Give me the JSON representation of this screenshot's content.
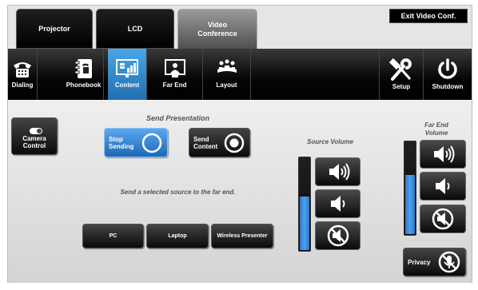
{
  "tabs": [
    {
      "label": "Projector"
    },
    {
      "label": "LCD"
    },
    {
      "label": "Video Conference"
    }
  ],
  "exit_label": "Exit Video Conf.",
  "nav": [
    {
      "label": "Dialing",
      "icon": "phone-icon"
    },
    {
      "label": "Phonebook",
      "icon": "phonebook-icon"
    },
    {
      "label": "Content",
      "icon": "content-icon"
    },
    {
      "label": "Far End",
      "icon": "far-end-icon"
    },
    {
      "label": "Layout",
      "icon": "layout-icon"
    },
    {
      "label": "Setup",
      "icon": "tools-icon"
    },
    {
      "label": "Shutdown",
      "icon": "power-icon"
    }
  ],
  "camera_control": "Camera Control",
  "send_presentation": {
    "heading": "Send Presentation",
    "stop_label": "Stop Sending",
    "send_label": "Send Content",
    "instruction": "Send a selected source to the far end."
  },
  "sources": [
    {
      "label": "PC"
    },
    {
      "label": "Laptop"
    },
    {
      "label": "Wireless Presenter"
    }
  ],
  "source_volume": {
    "label": "Source Volume",
    "level": 0.57
  },
  "far_end_volume": {
    "label": "Far End Volume",
    "level": 0.63
  },
  "privacy_label": "Privacy",
  "colors": {
    "selected": "#2f86d6",
    "fill": "#3b8de0"
  }
}
